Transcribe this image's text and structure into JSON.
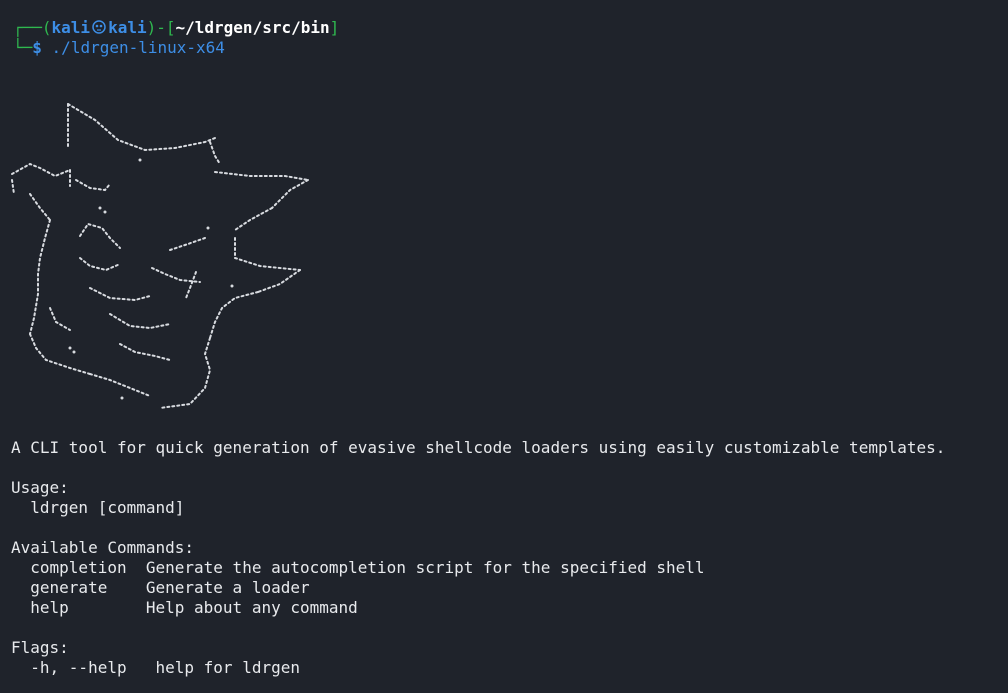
{
  "prompt": {
    "corner_top": "┌──(",
    "user": "kali",
    "host": "kali",
    "sep_close": ")-[",
    "path": "~/ldrgen/src/bin",
    "bracket_close": "]",
    "corner_bottom": "└─",
    "dollar": "$",
    "command": "./ldrgen-linux-x64"
  },
  "output": {
    "description": "A CLI tool for quick generation of evasive shellcode loaders using easily customizable templates.",
    "usage_header": "Usage:",
    "usage_line": "  ldrgen [command]",
    "commands_header": "Available Commands:",
    "commands": [
      {
        "name": "  completion",
        "desc": "  Generate the autocompletion script for the specified shell"
      },
      {
        "name": "  generate  ",
        "desc": "  Generate a loader"
      },
      {
        "name": "  help      ",
        "desc": "  Help about any command"
      }
    ],
    "flags_header": "Flags:",
    "flags_line": "  -h, --help   help for ldrgen"
  },
  "colors": {
    "background": "#1f232b",
    "prompt_blue": "#3d8ee6",
    "text": "#e8eaed"
  },
  "icons": {
    "prompt_separator": "skull-icon",
    "banner": "ascii-art-logo"
  }
}
